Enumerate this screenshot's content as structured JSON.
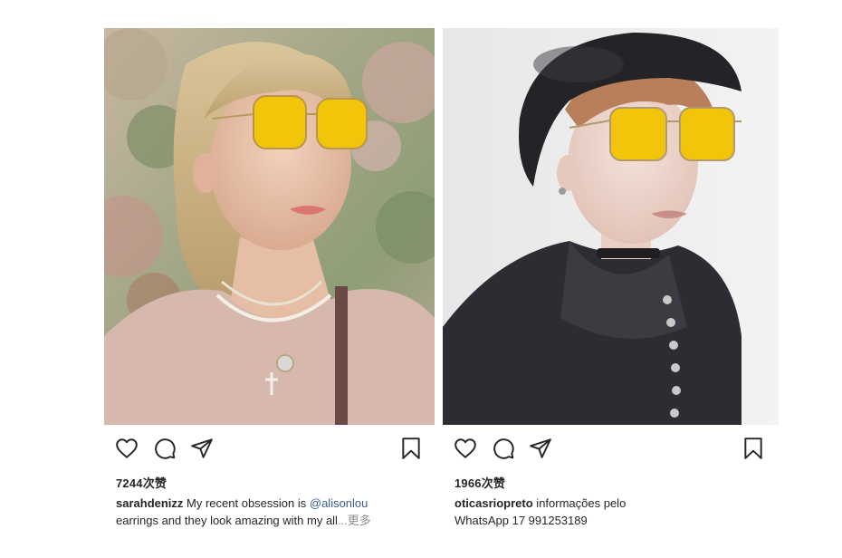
{
  "posts": [
    {
      "likes": "7244次赞",
      "username": "sarahdenizz",
      "caption_before": " My recent obsession is ",
      "mention": "@alisonlou",
      "caption_after": "earrings and they look amazing with my all",
      "ellipsis": "...",
      "more": "更多",
      "icons": [
        "heart-icon",
        "comment-icon",
        "share-icon",
        "bookmark-icon"
      ]
    },
    {
      "likes": "1966次赞",
      "username": "oticasriopreto",
      "caption_before": " informações pelo",
      "caption_after": "WhatsApp 17 991253189",
      "icons": [
        "heart-icon",
        "comment-icon",
        "share-icon",
        "bookmark-icon"
      ]
    }
  ],
  "colors": {
    "lens": "#f2c40a",
    "text": "#262626",
    "mention": "#3b5e8c",
    "muted": "#8e8e8e"
  }
}
